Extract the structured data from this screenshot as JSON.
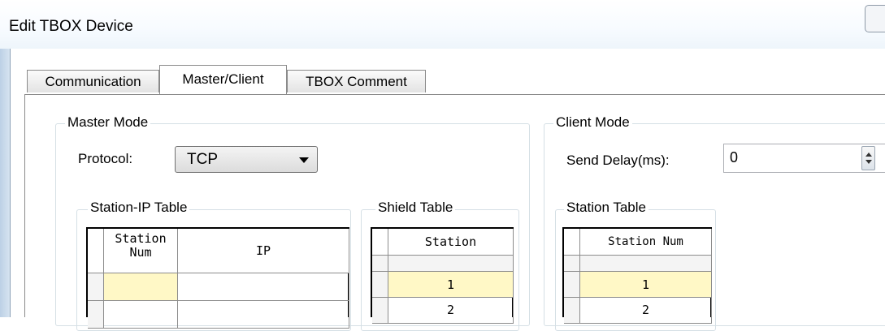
{
  "window": {
    "title": "Edit TBOX Device"
  },
  "tabs": [
    {
      "label": "Communication",
      "active": false
    },
    {
      "label": "Master/Client",
      "active": true
    },
    {
      "label": "TBOX Comment",
      "active": false
    }
  ],
  "master_mode": {
    "legend": "Master Mode",
    "protocol_label": "Protocol:",
    "protocol_value": "TCP",
    "station_ip_table": {
      "legend": "Station-IP Table",
      "headers": [
        "Station\nNum",
        "IP"
      ],
      "rows": [
        [
          "",
          ""
        ],
        [
          "",
          ""
        ]
      ]
    },
    "shield_table": {
      "legend": "Shield Table",
      "header": "Station",
      "rows": [
        "1",
        "2"
      ]
    }
  },
  "client_mode": {
    "legend": "Client Mode",
    "send_delay_label": "Send Delay(ms):",
    "send_delay_value": "0",
    "station_table": {
      "legend": "Station Table",
      "header": "Station Num",
      "rows": [
        "1",
        "2"
      ]
    }
  },
  "colors": {
    "selected_cell": "#fff8c6",
    "border": "#8a8a8a"
  }
}
